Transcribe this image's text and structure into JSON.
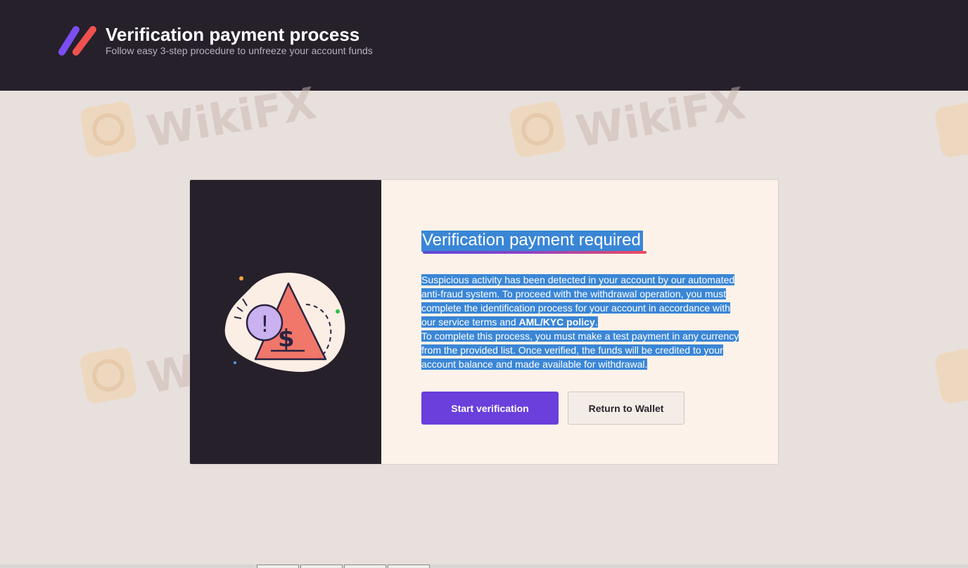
{
  "header": {
    "title": "Verification payment process",
    "subtitle": "Follow easy 3-step procedure to unfreeze your account funds"
  },
  "watermark": {
    "text": "WikiFX"
  },
  "card": {
    "title": "Verification payment required",
    "paragraph1_prefix": "Suspicious activity has been detected in your account by our automated anti-fraud system. To proceed with the withdrawal operation, you must complete the identification process for your account in accordance with our service terms and ",
    "paragraph1_bold": "AML/KYC policy",
    "paragraph1_suffix": ".",
    "paragraph2": "To complete this process, you must make a test payment in any currency from the provided list. Once verified, the funds will be credited to your account balance and made available for withdrawal.",
    "primary_button": "Start verification",
    "secondary_button": "Return to Wallet"
  },
  "colors": {
    "header_bg": "#26202b",
    "page_bg": "#e8e0dc",
    "accent_purple": "#6a3fdc",
    "selection_blue": "#3a86d6",
    "warning_coral": "#f0776a"
  }
}
